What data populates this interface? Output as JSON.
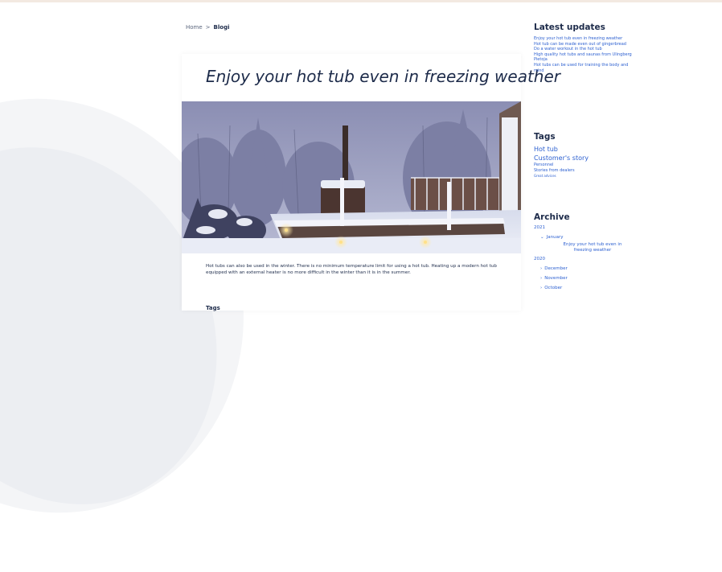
{
  "breadcrumb": {
    "home": "Home",
    "separator": ">",
    "current": "Blogi"
  },
  "article": {
    "title": "Enjoy your hot tub even in freezing weather",
    "image_subject": "snowy-backyard-hot-tub-photo",
    "intro": "Hot tubs can also be used in the winter. There is no minimum temperature limit for using a hot tub. Heating up a modern hot tub equipped with an external heater is no more difficult in the winter than it is in the summer.",
    "tags_heading": "Tags"
  },
  "sidebar": {
    "latest_heading": "Latest updates",
    "latest_items": [
      "Enjoy your hot tub even in freezing weather",
      "Hot tub can be made even out of gingerbread",
      "Do a water workout in the hot tub",
      "High quality hot tubs and saunas from Ulingberg Pietoja",
      "Hot tubs can be used for training the body and mind"
    ],
    "tags_heading": "Tags",
    "tags": [
      {
        "label": "Hot tub",
        "size": "lg"
      },
      {
        "label": "Customer's story",
        "size": "lg"
      },
      {
        "label": "Personnel",
        "size": "sm"
      },
      {
        "label": "Stories from dealers",
        "size": "sm"
      },
      {
        "label": "Great advices",
        "size": "xs"
      }
    ],
    "archive_heading": "Archive",
    "archive": {
      "year_current": "2021",
      "month_open": "January",
      "open_post": "Enjoy your hot tub even in freezing weather",
      "year_prev": "2020",
      "months_prev": [
        "December",
        "November",
        "October"
      ]
    }
  },
  "colors": {
    "text_dark": "#1d2b4a",
    "link_blue": "#2b5fd0",
    "background": "#ffffff"
  }
}
